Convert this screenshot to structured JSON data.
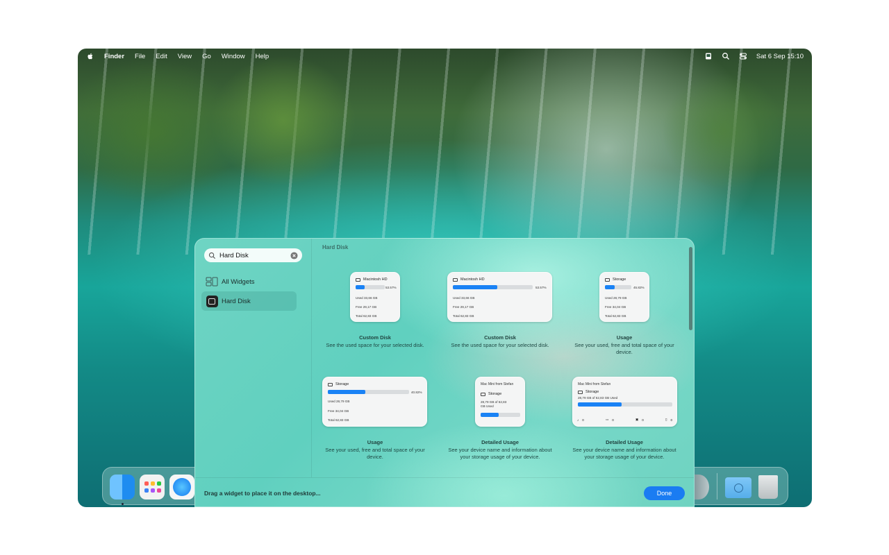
{
  "menubar": {
    "items": [
      "Finder",
      "File",
      "Edit",
      "View",
      "Go",
      "Window",
      "Help"
    ],
    "clock": "Sat 6 Sep  15:10"
  },
  "gallery": {
    "search": {
      "value": "Hard Disk"
    },
    "sidebar": {
      "all_widgets": "All Widgets",
      "hard_disk": "Hard Disk"
    },
    "section_title": "Hard Disk",
    "widgets": [
      {
        "title": "Custom Disk",
        "desc": "See the used space for your selected disk.",
        "card": {
          "name": "Macintosh HD",
          "percent": "53.57%",
          "fill": 0.3,
          "used": "Used 33,66 GB",
          "free": "Free 29,17 GB",
          "total": "Total 62,83 GB"
        }
      },
      {
        "title": "Custom Disk",
        "desc": "See the used space for your selected disk.",
        "card": {
          "name": "Macintosh HD",
          "percent": "53.57%",
          "fill": 0.56,
          "used": "Used 33,66 GB",
          "free": "Free 29,17 GB",
          "total": "Total 62,83 GB"
        }
      },
      {
        "title": "Usage",
        "desc": "See your used, free and total space of your device.",
        "card": {
          "name": "Storage",
          "percent": "45.82%",
          "fill": 0.38,
          "used": "Used 28,79 GB",
          "free": "Free 34,04 GB",
          "total": "Total 62,83 GB"
        }
      },
      {
        "title": "Usage",
        "desc": "See your used, free and total space of your device.",
        "card": {
          "name": "Storage",
          "percent": "40.82%",
          "fill": 0.46,
          "used": "Used 28,79 GB",
          "free": "Free 34,04 GB",
          "total": "Total 62,83 GB"
        }
      },
      {
        "title": "Detailed Usage",
        "desc": "See your device name and information about your storage usage of your device.",
        "card": {
          "device": "Mac Mini from Stefan",
          "name": "Storage",
          "summary": "28,79 GB of 62,83 GB Used",
          "fill": 0.46
        }
      },
      {
        "title": "Detailed Usage",
        "desc": "See your device name and information about your storage usage of your device.",
        "card": {
          "device": "Mac Mini from Stefan",
          "name": "Storage",
          "summary": "28,79 GB of 62,83 GB Used",
          "fill": 0.46,
          "counts": [
            "0",
            "0",
            "0",
            "0"
          ]
        }
      }
    ],
    "footer_hint": "Drag a widget to place it on the desktop...",
    "done_label": "Done"
  }
}
